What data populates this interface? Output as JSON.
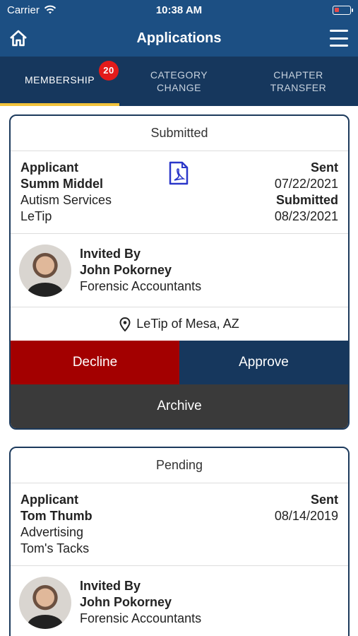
{
  "status_bar": {
    "carrier": "Carrier",
    "time": "10:38 AM"
  },
  "header": {
    "title": "Applications"
  },
  "tabs": [
    {
      "label": "MEMBERSHIP",
      "badge": "20",
      "active": true
    },
    {
      "label": "CATEGORY CHANGE",
      "active": false
    },
    {
      "label": "CHAPTER TRANSFER",
      "active": false
    }
  ],
  "cards": [
    {
      "status": "Submitted",
      "applicant_label": "Applicant",
      "applicant_name": "Summ Middel",
      "applicant_category": "Autism Services",
      "applicant_org": "LeTip",
      "sent_label": "Sent",
      "sent_date": "07/22/2021",
      "submitted_label": "Submitted",
      "submitted_date": "08/23/2021",
      "invited_label": "Invited By",
      "inviter_name": "John Pokorney",
      "inviter_category": "Forensic Accountants",
      "location": "LeTip of Mesa, AZ",
      "decline_label": "Decline",
      "approve_label": "Approve",
      "archive_label": "Archive"
    },
    {
      "status": "Pending",
      "applicant_label": "Applicant",
      "applicant_name": "Tom Thumb",
      "applicant_category": "Advertising",
      "applicant_org": "Tom's Tacks",
      "sent_label": "Sent",
      "sent_date": "08/14/2019",
      "invited_label": "Invited By",
      "inviter_name": "John Pokorney",
      "inviter_category": "Forensic Accountants"
    }
  ],
  "colors": {
    "header_bg": "#1c4f83",
    "tabs_bg": "#16375d",
    "tab_indicator": "#f2c33b",
    "badge": "#e31b1b",
    "decline": "#a30000",
    "approve": "#16375d",
    "archive": "#3a3a3a"
  },
  "icons": [
    "wifi-icon",
    "battery-icon",
    "home-icon",
    "menu-icon",
    "pdf-icon",
    "location-pin-icon"
  ]
}
